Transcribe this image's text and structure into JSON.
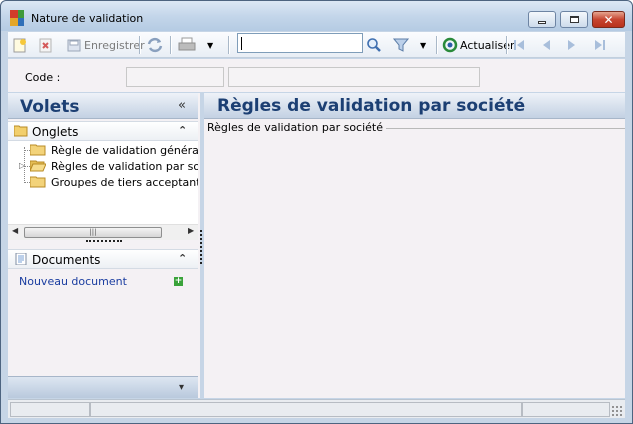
{
  "window": {
    "title": "Nature de validation",
    "icon": "app-colored-squares-icon"
  },
  "toolbar": {
    "new_icon": "new-document-icon",
    "delete_icon": "delete-icon",
    "save_label": "Enregistrer",
    "refresh_icon": "refresh-icon",
    "print_icon": "printer-icon",
    "search_value": "",
    "search_icon": "magnifier-icon",
    "filter_icon": "funnel-icon",
    "actualiser_label": "Actualiser",
    "nav_icons": [
      "first-icon",
      "previous-icon",
      "next-icon",
      "last-icon"
    ]
  },
  "code_row": {
    "label": "Code :",
    "code_value": "",
    "description_value": ""
  },
  "left_panel": {
    "title": "Volets",
    "collapse_glyph": "«",
    "onglets": {
      "label": "Onglets",
      "collapse_glyph": "⌃",
      "items": [
        {
          "label": "Règle de validation générale",
          "expandable": false
        },
        {
          "label": "Règles de validation par sociétés",
          "expandable": true
        },
        {
          "label": "Groupes de tiers acceptant la règle",
          "expandable": false
        }
      ]
    },
    "documents": {
      "label": "Documents",
      "collapse_glyph": "⌃",
      "new_document_label": "Nouveau document"
    },
    "bottom_glyph": "▾"
  },
  "main_panel": {
    "title": "Règles de validation par société",
    "section_label": "Règles de validation par société"
  },
  "colors": {
    "header_text": "#1c3f73",
    "link": "#1a3da0",
    "panel_bg": "#f4f1f4",
    "frame": "#c6d5e6"
  }
}
